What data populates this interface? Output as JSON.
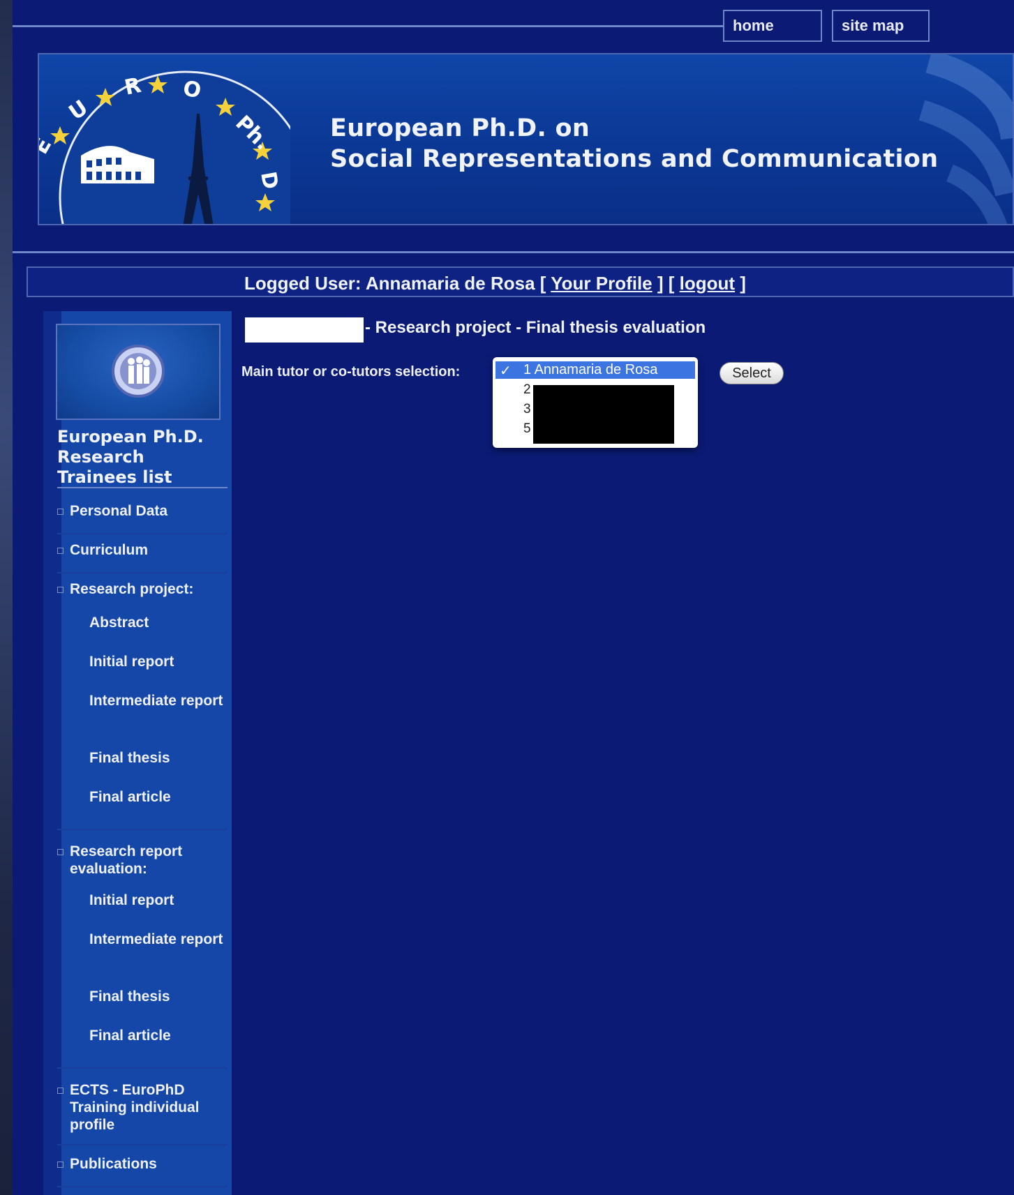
{
  "nav": {
    "home_label": "home",
    "sitemap_label": "site map"
  },
  "banner": {
    "title_line1": "European Ph.D.  on",
    "title_line2": "Social Representations and Communication",
    "logo_text": "EURO Ph.D."
  },
  "user_bar": {
    "prefix": "Logged User: Annamaria de Rosa [ ",
    "profile_link": "Your Profile",
    "middle": " ] [ ",
    "logout_link": "logout",
    "suffix": " ]"
  },
  "sidebar": {
    "title": "European Ph.D. Research Trainees list",
    "items": [
      {
        "label": "Personal Data"
      },
      {
        "label": "Curriculum"
      },
      {
        "label": "Research project:",
        "subitems": [
          "Abstract",
          "Initial report",
          "Intermediate report",
          "Final thesis",
          "Final article"
        ]
      },
      {
        "label": "Research report evaluation:",
        "subitems": [
          "Initial report",
          "Intermediate report",
          "Final thesis",
          "Final article"
        ]
      },
      {
        "label": "ECTS - EuroPhD Training individual profile"
      },
      {
        "label": "Publications"
      }
    ]
  },
  "main": {
    "heading": "- Research project - Final thesis evaluation",
    "selection_label": "Main tutor or co-tutors selection:",
    "dropdown": {
      "checkmark": "✓",
      "selected": "1 Annamaria de Rosa",
      "options": [
        "2",
        "3",
        "5"
      ]
    },
    "select_button": "Select"
  },
  "colors": {
    "page_bg": "#0b1a75",
    "banner": "#0b3a98",
    "sidebar": "#1447a8",
    "rule": "#6f86c8",
    "highlight": "#3c74e2"
  }
}
